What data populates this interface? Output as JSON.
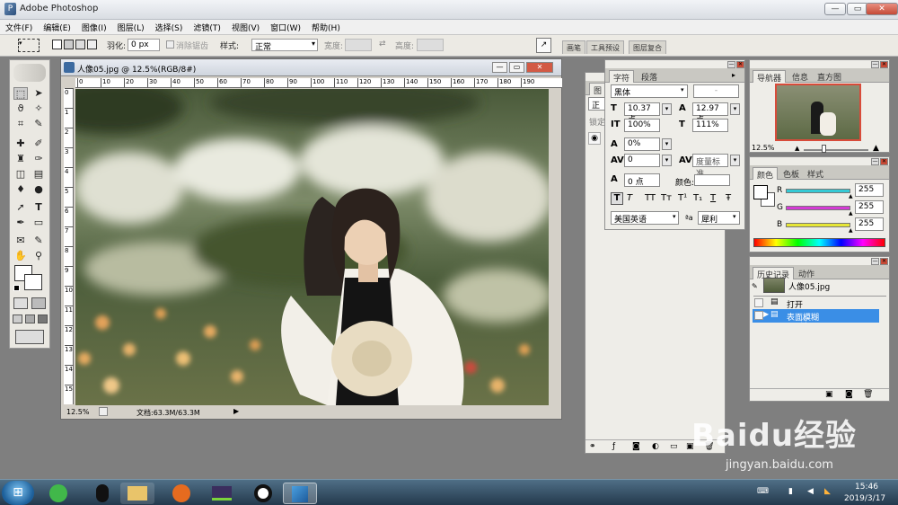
{
  "app": {
    "title": "Adobe Photoshop"
  },
  "window_controls": {
    "minimize": "—",
    "restore": "▭",
    "close": "✕"
  },
  "menu": [
    "文件(F)",
    "编辑(E)",
    "图像(I)",
    "图层(L)",
    "选择(S)",
    "滤镜(T)",
    "视图(V)",
    "窗口(W)",
    "帮助(H)"
  ],
  "options": {
    "feather_label": "羽化:",
    "feather_value": "0 px",
    "antialias_label": "消除锯齿",
    "style_label": "样式:",
    "style_value": "正常",
    "width_label": "宽度:",
    "height_label": "高度:",
    "palette_tabs": [
      "画笔",
      "工具预设",
      "图层复合"
    ]
  },
  "document": {
    "title": "人像05.jpg @ 12.5%(RGB/8#)",
    "zoom": "12.5%",
    "doc_size": "文档:63.3M/63.3M",
    "ruler_top": [
      "0",
      "10",
      "20",
      "30",
      "40",
      "50",
      "60",
      "70",
      "80",
      "90",
      "100",
      "110",
      "120",
      "130",
      "140",
      "150",
      "160",
      "170",
      "180",
      "190"
    ],
    "ruler_left": [
      "0",
      "1",
      "2",
      "3",
      "4",
      "5",
      "6",
      "7",
      "8",
      "9",
      "10",
      "11",
      "12",
      "13",
      "14",
      "15"
    ]
  },
  "layers_panel": {
    "tab": "图",
    "blend": "正",
    "lock": "锁定"
  },
  "character_panel": {
    "tabs": [
      "字符",
      "段落"
    ],
    "font_family": "黑体",
    "font_style": "-",
    "font_size": "10.37 点",
    "leading": "12.97 点",
    "vertical_scale": "100%",
    "horizontal_scale": "111%",
    "tracking": "0%",
    "kerning": "0",
    "kerning_method": "度量标准",
    "baseline_shift": "0 点",
    "color_label": "颜色:",
    "language": "美国英语",
    "antialias_icon": "ªa",
    "antialias": "犀利",
    "style_buttons": [
      "T",
      "T",
      "TT",
      "Tт",
      "T¹",
      "T₁",
      "T",
      "Ŧ"
    ]
  },
  "navigator_panel": {
    "tabs": [
      "导航器",
      "信息",
      "直方图"
    ],
    "zoom": "12.5%"
  },
  "color_panel": {
    "tabs": [
      "颜色",
      "色板",
      "样式"
    ],
    "channels": [
      {
        "label": "R",
        "value": "255",
        "color": "#35c9d4"
      },
      {
        "label": "G",
        "value": "255",
        "color": "#d43bd4"
      },
      {
        "label": "B",
        "value": "255",
        "color": "#e6e636"
      }
    ]
  },
  "history_panel": {
    "tabs": [
      "历史记录",
      "动作"
    ],
    "snapshot": "人像05.jpg",
    "items": [
      {
        "label": "打开",
        "selected": false
      },
      {
        "label": "表面模糊",
        "selected": true
      }
    ]
  },
  "taskbar": {
    "time": "15:46",
    "date": "2019/3/17"
  },
  "watermark": {
    "brand": "Baidu经验",
    "url": "jingyan.baidu.com"
  }
}
